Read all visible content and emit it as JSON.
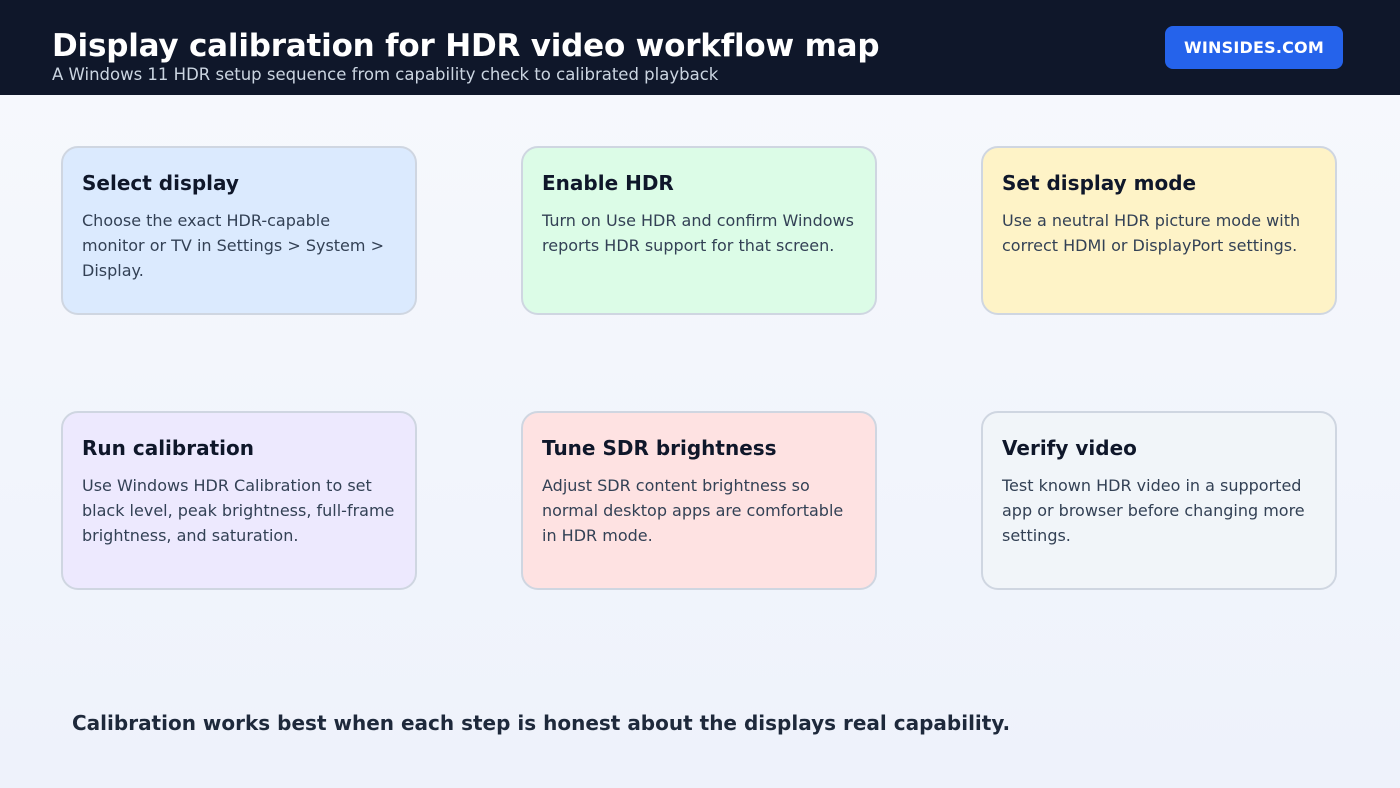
{
  "header": {
    "title": "Display calibration for HDR video workflow map",
    "subtitle": "A Windows 11 HDR setup sequence from capability check to calibrated playback",
    "brand": "WINSIDES.COM"
  },
  "steps": [
    {
      "title": "Select display",
      "text": "Choose the exact HDR-capable monitor or TV in Settings > System > Display.",
      "color": "#dbeafe"
    },
    {
      "title": "Enable HDR",
      "text": "Turn on Use HDR and confirm Windows reports HDR support for that screen.",
      "color": "#dcfce7"
    },
    {
      "title": "Set display mode",
      "text": "Use a neutral HDR picture mode with correct HDMI or DisplayPort settings.",
      "color": "#fef3c7"
    },
    {
      "title": "Run calibration",
      "text": "Use Windows HDR Calibration to set black level, peak brightness, full-frame brightness, and saturation.",
      "color": "#ede9fe"
    },
    {
      "title": "Tune SDR brightness",
      "text": "Adjust SDR content brightness so normal desktop apps are comfortable in HDR mode.",
      "color": "#fee2e2"
    },
    {
      "title": "Verify video",
      "text": "Test known HDR video in a supported app or browser before changing more settings.",
      "color": "#f1f5f9"
    }
  ],
  "footer": {
    "note": "Calibration works best when each step is honest about the displays real capability."
  },
  "colors": {
    "header_bg": "#0f172a",
    "brand_accent": "#2563eb"
  }
}
